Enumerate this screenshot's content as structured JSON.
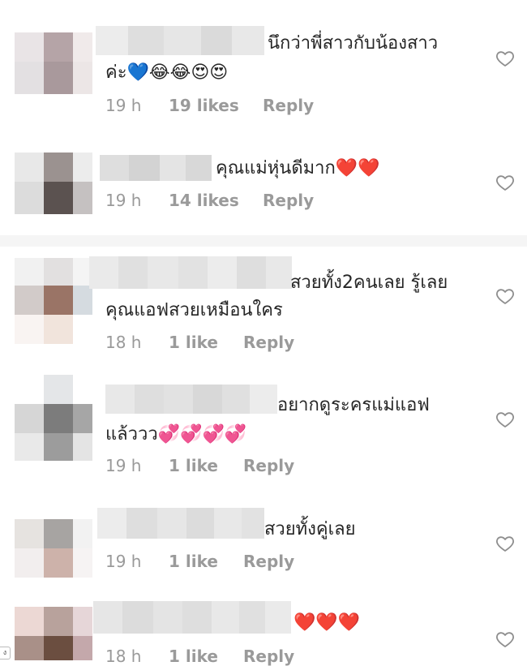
{
  "comments": [
    {
      "text_line1": "นึกว่าพี่สาวกับน้องสาว",
      "text_line2": "ค่ะ💙😂😂😍😍",
      "time": "19 h",
      "likes": "19 likes",
      "reply": "Reply",
      "liked": false
    },
    {
      "text_line1": "คุณแม่หุ่นดีมาก❤️❤️",
      "text_line2": "",
      "time": "19 h",
      "likes": "14 likes",
      "reply": "Reply",
      "liked": false
    },
    {
      "text_line1": "สวยทั้ง2คนเลย รู้เลย",
      "text_line2": "คุณแอฟสวยเหมือนใคร",
      "time": "18 h",
      "likes": "1 like",
      "reply": "Reply",
      "liked": false
    },
    {
      "text_line1": "อยากดูระครแม่แอฟ",
      "text_line2": "แล้ววว💞💞💞💞",
      "time": "19 h",
      "likes": "1 like",
      "reply": "Reply",
      "liked": false
    },
    {
      "text_line1": "สวยทั้งคู่เลย",
      "text_line2": "",
      "time": "19 h",
      "likes": "1 like",
      "reply": "Reply",
      "liked": false
    },
    {
      "text_line1": "❤️❤️❤️",
      "text_line2": "",
      "time": "18 h",
      "likes": "1 like",
      "reply": "Reply",
      "liked": false
    }
  ],
  "icons": {
    "like": "heart-outline-icon"
  },
  "colors": {
    "text": "#262626",
    "meta": "#9a9a9a",
    "heart_outline": "#8e8e8e",
    "divider": "#f5f5f5"
  },
  "corner_glyph": "ง"
}
